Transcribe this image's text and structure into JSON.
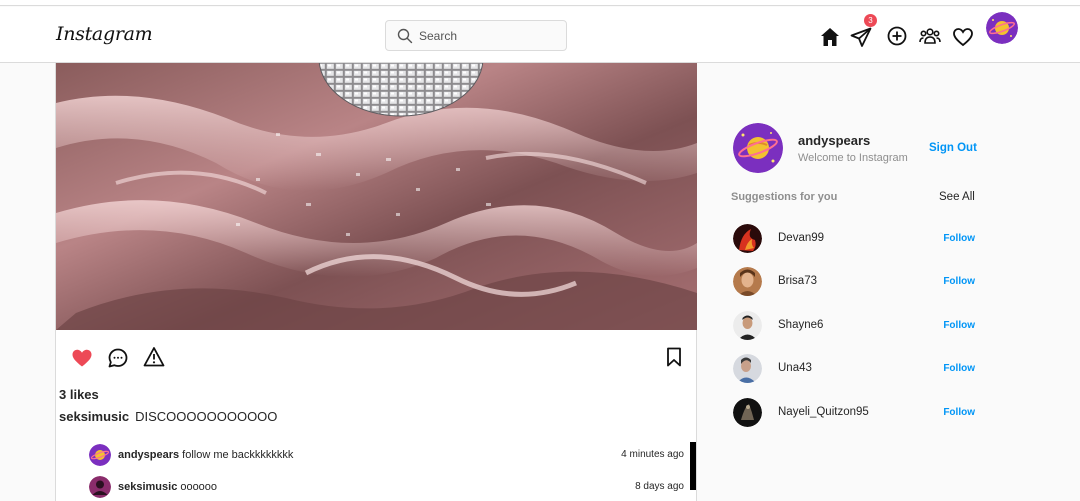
{
  "app": {
    "logo": "Instagram"
  },
  "search": {
    "placeholder": "Search",
    "value": ""
  },
  "nav": {
    "dm_badge_count": "3"
  },
  "post": {
    "likes": "3 likes",
    "caption_user": "seksimusic",
    "caption_text": "DISCOOOOOOOOOOO",
    "comments": [
      {
        "user": "andyspears",
        "text": "follow me backkkkkkkk",
        "time": "4 minutes ago"
      },
      {
        "user": "seksimusic",
        "text": "oooooo",
        "time": "8 days ago"
      }
    ]
  },
  "sidebar": {
    "profile_name": "andyspears",
    "profile_sub": "Welcome to Instagram",
    "signout_label": "Sign Out",
    "suggestions_title": "Suggestions for you",
    "see_all_label": "See All",
    "suggestions": [
      {
        "name": "Devan99",
        "action": "Follow"
      },
      {
        "name": "Brisa73",
        "action": "Follow"
      },
      {
        "name": "Shayne6",
        "action": "Follow"
      },
      {
        "name": "Una43",
        "action": "Follow"
      },
      {
        "name": "Nayeli_Quitzon95",
        "action": "Follow"
      }
    ]
  },
  "colors": {
    "accent": "#0095f6",
    "like": "#ed4956",
    "avatar_purple": "#7b2fbf",
    "planet": "#f2c230"
  }
}
